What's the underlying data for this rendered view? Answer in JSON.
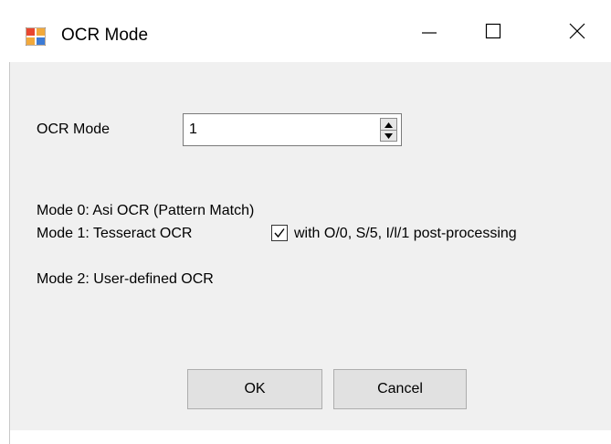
{
  "window": {
    "title": "OCR Mode",
    "app_icon": "windows-form-icon",
    "controls": {
      "minimize": "minimize-icon",
      "maximize": "maximize-icon",
      "close": "close-icon"
    }
  },
  "form": {
    "ocr_mode_label": "OCR Mode",
    "ocr_mode_value": "1",
    "mode0_text": "Mode 0: Asi OCR (Pattern Match)",
    "mode1_text": "Mode 1: Tesseract OCR",
    "postprocess_checked": true,
    "postprocess_label": "with O/0, S/5, I/l/1 post-processing",
    "mode2_text": "Mode 2: User-defined OCR"
  },
  "buttons": {
    "ok": "OK",
    "cancel": "Cancel"
  }
}
